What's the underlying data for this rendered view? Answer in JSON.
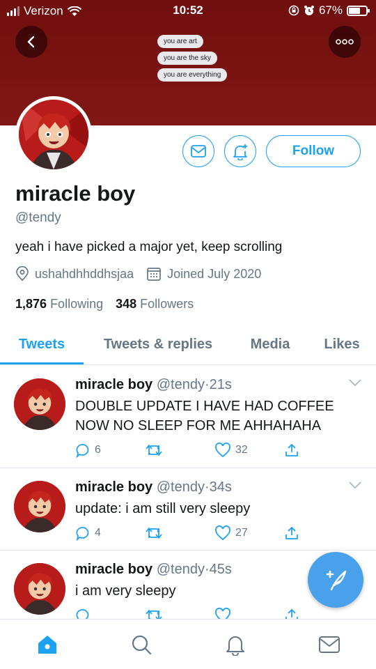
{
  "status_bar": {
    "carrier": "Verizon",
    "time": "10:52",
    "battery": "67%",
    "battery_level": 0.67
  },
  "banner": {
    "messages": [
      "you are art",
      "you are the sky",
      "you are everything"
    ]
  },
  "profile": {
    "name": "miracle boy",
    "handle": "@tendy",
    "bio": "yeah i have picked a major yet, keep scrolling",
    "location": "ushahdhhddhsjaa",
    "joined": "Joined July 2020",
    "following_count": "1,876",
    "following_label": "Following",
    "followers_count": "348",
    "followers_label": "Followers",
    "follow_label": "Follow"
  },
  "tabs": [
    "Tweets",
    "Tweets & replies",
    "Media",
    "Likes"
  ],
  "tweets": [
    {
      "name": "miracle boy",
      "handle": "@tendy",
      "time": "21s",
      "sep": "·",
      "text": "DOUBLE UPDATE I HAVE HAD COFFEE NOW NO SLEEP FOR ME AHHAHAHA",
      "replies": "6",
      "retweets": "",
      "likes": "32"
    },
    {
      "name": "miracle boy",
      "handle": "@tendy",
      "time": "34s",
      "sep": "·",
      "text": "update: i am still very sleepy",
      "replies": "4",
      "retweets": "",
      "likes": "27"
    },
    {
      "name": "miracle boy",
      "handle": "@tendy",
      "time": "45s",
      "sep": "·",
      "text": "i am very sleepy",
      "replies": "",
      "retweets": "",
      "likes": ""
    }
  ],
  "colors": {
    "accent": "#1da1f2",
    "banner": "#7a1412",
    "fab": "#4aa1eb",
    "muted": "#657786"
  }
}
